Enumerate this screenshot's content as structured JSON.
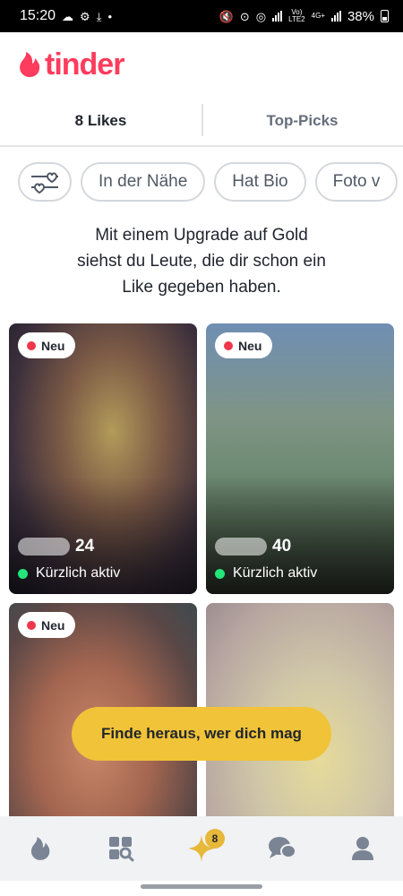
{
  "status_bar": {
    "time": "15:20",
    "network_label_top": "Vo)",
    "network_label_bottom": "LTE2",
    "network_4g": "4G+",
    "battery": "38%"
  },
  "app": {
    "logo_text": "tinder",
    "brand_color": "#fe3c5d"
  },
  "tabs": [
    {
      "label": "8 Likes",
      "active": true
    },
    {
      "label": "Top-Picks",
      "active": false
    }
  ],
  "filters": {
    "icon": "filter-sliders-icon",
    "chips": [
      "In der Nähe",
      "Hat Bio",
      "Foto v"
    ]
  },
  "upgrade_message": {
    "line1": "Mit einem Upgrade auf Gold",
    "line2": "siehst du Leute, die dir schon ein",
    "line3": "Like gegeben haben."
  },
  "cards": [
    {
      "badge": "Neu",
      "age": "24",
      "status": "Kürzlich aktiv"
    },
    {
      "badge": "Neu",
      "age": "40",
      "status": "Kürzlich aktiv"
    },
    {
      "badge": "Neu"
    },
    {}
  ],
  "cta": {
    "label": "Finde heraus, wer dich mag",
    "color": "#f1c338"
  },
  "bottom_nav": {
    "items": [
      "flame-icon",
      "explore-icon",
      "sparkle-icon",
      "chat-icon",
      "profile-icon"
    ],
    "likes_badge": "8"
  }
}
